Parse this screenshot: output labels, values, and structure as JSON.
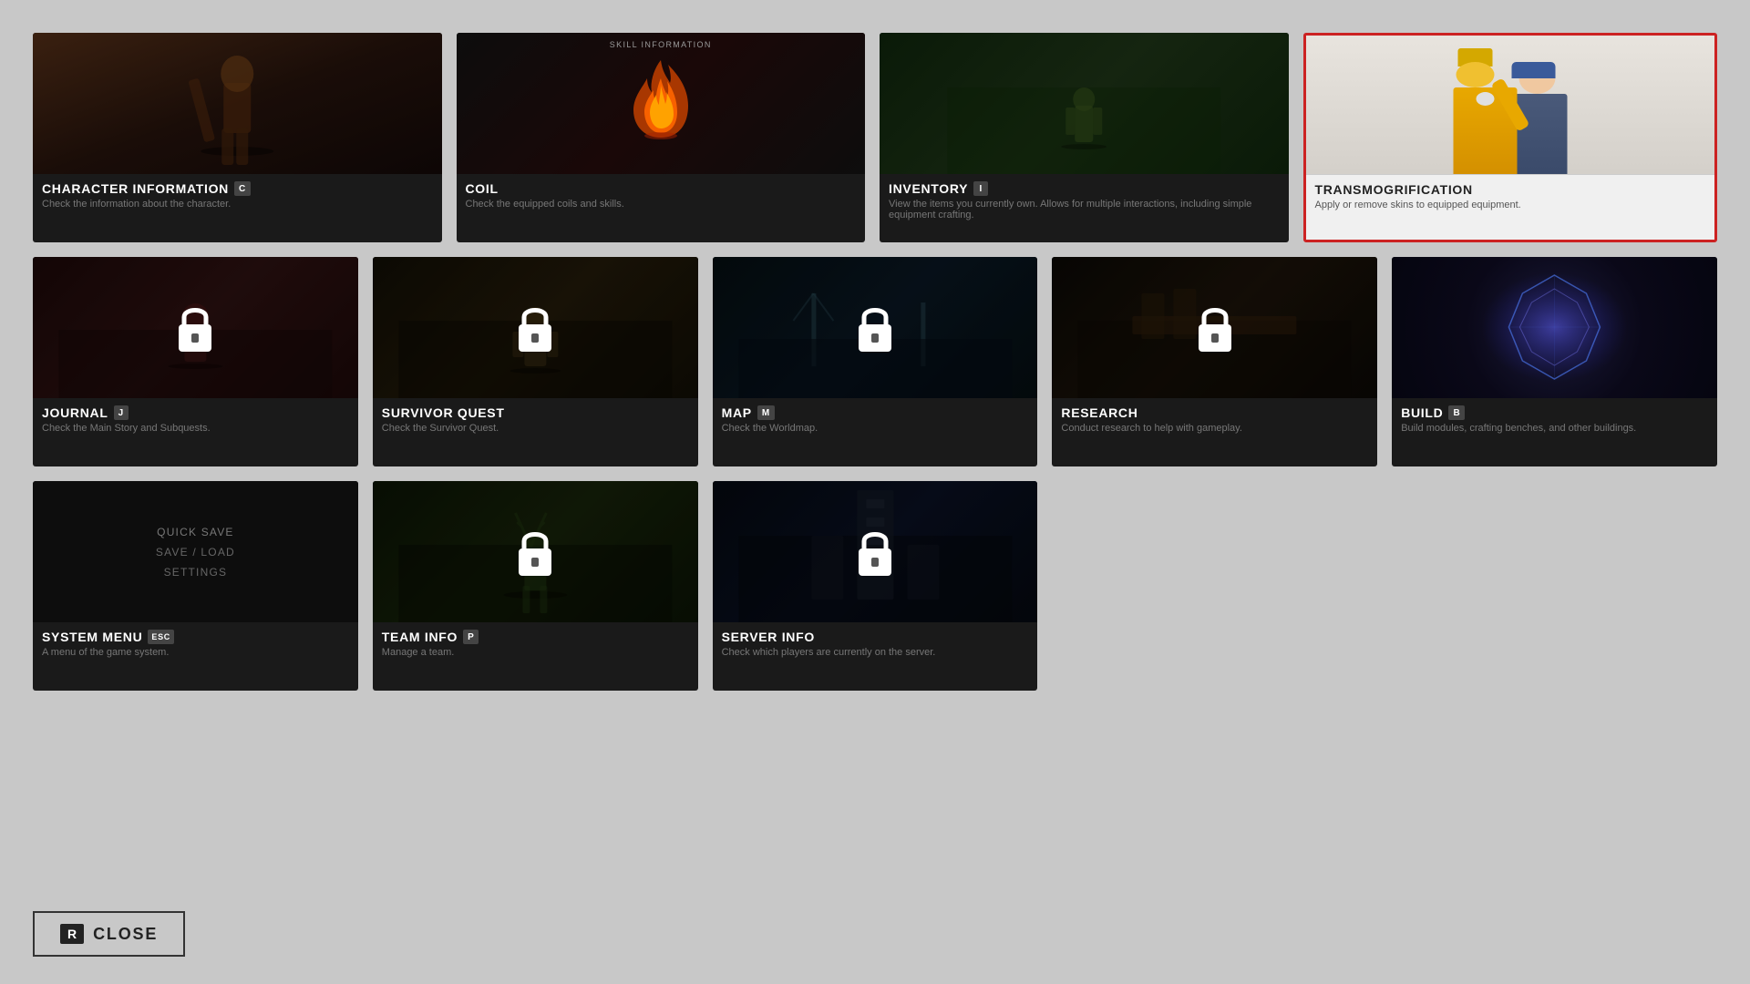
{
  "background_color": "#c8c8c8",
  "cards": [
    {
      "id": "character-information",
      "title": "CHARACTER INFORMATION",
      "key": "C",
      "description": "Check the information about the character.",
      "locked": false,
      "selected": false,
      "row": 1
    },
    {
      "id": "coil",
      "title": "COIL",
      "key": null,
      "description": "Check the equipped coils and skills.",
      "locked": false,
      "selected": false,
      "row": 1
    },
    {
      "id": "inventory",
      "title": "INVENTORY",
      "key": "I",
      "description": "View the items you currently own. Allows for multiple interactions, including simple equipment crafting.",
      "locked": false,
      "selected": false,
      "row": 1
    },
    {
      "id": "transmogrification",
      "title": "TRANSMOGRIFICATION",
      "key": null,
      "description": "Apply or remove skins to equipped equipment.",
      "locked": false,
      "selected": true,
      "row": 1
    },
    {
      "id": "journal",
      "title": "JOURNAL",
      "key": "J",
      "description": "Check the Main Story and Subquests.",
      "locked": true,
      "selected": false,
      "row": 2
    },
    {
      "id": "survivor-quest",
      "title": "SURVIVOR QUEST",
      "key": null,
      "description": "Check the Survivor Quest.",
      "locked": true,
      "selected": false,
      "row": 2
    },
    {
      "id": "map",
      "title": "MAP",
      "key": "M",
      "description": "Check the Worldmap.",
      "locked": true,
      "selected": false,
      "row": 2
    },
    {
      "id": "research",
      "title": "RESEARCH",
      "key": null,
      "description": "Conduct research to help with gameplay.",
      "locked": true,
      "selected": false,
      "row": 2
    },
    {
      "id": "build",
      "title": "BUILD",
      "key": "B",
      "description": "Build modules, crafting benches, and other buildings.",
      "locked": false,
      "selected": false,
      "row": 2
    },
    {
      "id": "system-menu",
      "title": "SYSTEM MENU",
      "key": "ESC",
      "description": "A menu of the game system.",
      "locked": false,
      "selected": false,
      "row": 3,
      "system_items": [
        "QUICK SAVE",
        "SAVE / LOAD",
        "SETTINGS"
      ]
    },
    {
      "id": "team-info",
      "title": "TEAM INFO",
      "key": "P",
      "description": "Manage a team.",
      "locked": true,
      "selected": false,
      "row": 3
    },
    {
      "id": "server-info",
      "title": "SERVER INFO",
      "key": null,
      "description": "Check which players are currently on the server.",
      "locked": true,
      "selected": false,
      "row": 3
    }
  ],
  "close_button": {
    "key": "R",
    "label": "CLOSE"
  }
}
